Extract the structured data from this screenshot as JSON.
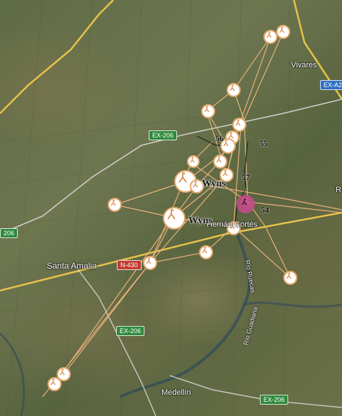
{
  "map": {
    "place_labels": {
      "santa_amalia": "Santa Amalia",
      "vivares": "Vivares",
      "medellin": "Medellín",
      "hernan_cortes": "Hernán Cortés",
      "rio_ruecas": "Río Ruecas",
      "rio_guadiana": "Río Guadiana",
      "edge_r": "R"
    },
    "road_labels": {
      "ex206_top": "EX-206",
      "ex206_left": "206",
      "ex206_mid": "EX-206",
      "ex206_bottom": "EX-206",
      "n430": "N-430",
      "exa2": "EX-A2"
    },
    "track_numbers": {
      "n55": "55",
      "n57": "57",
      "n54": "54",
      "n56": "56"
    },
    "bird_names": {
      "wyns_1": "Wyns",
      "wyns_2": "Wyns"
    },
    "colors": {
      "track": "#e9b27a",
      "marker_border": "#e2a86a",
      "highlight": "#c94b8c"
    },
    "icon": "stork-icon"
  }
}
